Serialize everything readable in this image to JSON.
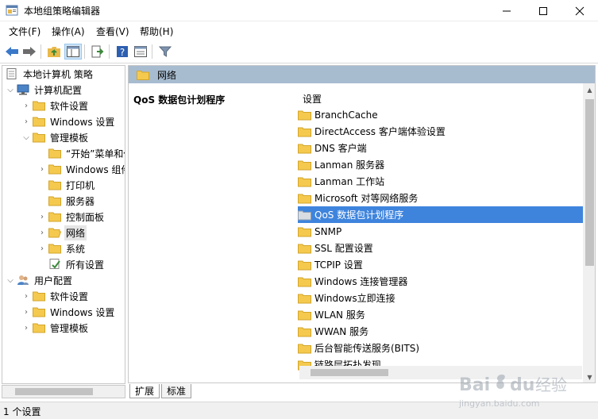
{
  "window": {
    "title": "本地组策略编辑器"
  },
  "menu": [
    {
      "label": "文件(F)"
    },
    {
      "label": "操作(A)"
    },
    {
      "label": "查看(V)"
    },
    {
      "label": "帮助(H)"
    }
  ],
  "tree": {
    "root": "本地计算机 策略",
    "computer_config": "计算机配置",
    "items": [
      {
        "label": "软件设置"
      },
      {
        "label": "Windows 设置"
      },
      {
        "label": "管理模板"
      },
      {
        "label": "“开始”菜单和任务栏"
      },
      {
        "label": "Windows 组件"
      },
      {
        "label": "打印机"
      },
      {
        "label": "服务器"
      },
      {
        "label": "控制面板"
      },
      {
        "label": "网络"
      },
      {
        "label": "系统"
      },
      {
        "label": "所有设置"
      },
      {
        "label": "用户配置"
      },
      {
        "label": "软件设置"
      },
      {
        "label": "Windows 设置"
      },
      {
        "label": "管理模板"
      }
    ],
    "selected": "网络"
  },
  "right_pane": {
    "header": "网络",
    "description_title": "QoS 数据包计划程序",
    "column_header": "设置",
    "items": [
      {
        "label": "BranchCache"
      },
      {
        "label": "DirectAccess 客户端体验设置"
      },
      {
        "label": "DNS 客户端"
      },
      {
        "label": "Lanman 服务器"
      },
      {
        "label": "Lanman 工作站"
      },
      {
        "label": "Microsoft 对等网络服务"
      },
      {
        "label": "QoS 数据包计划程序"
      },
      {
        "label": "SNMP"
      },
      {
        "label": "SSL 配置设置"
      },
      {
        "label": "TCPIP 设置"
      },
      {
        "label": "Windows 连接管理器"
      },
      {
        "label": "Windows立即连接"
      },
      {
        "label": "WLAN 服务"
      },
      {
        "label": "WWAN 服务"
      },
      {
        "label": "后台智能传送服务(BITS)"
      },
      {
        "label": "链路层拓扑发现"
      }
    ],
    "selected": "QoS 数据包计划程序"
  },
  "tabs": [
    {
      "label": "扩展"
    },
    {
      "label": "标准"
    }
  ],
  "status": {
    "text": "1 个设置"
  },
  "watermark": {
    "line1": "Baidu 经验",
    "line2": "jingyan.baidu.com"
  },
  "colors": {
    "selection": "#3e84dd",
    "header_band": "#a8bcd0",
    "folder": "#f4c94e"
  }
}
